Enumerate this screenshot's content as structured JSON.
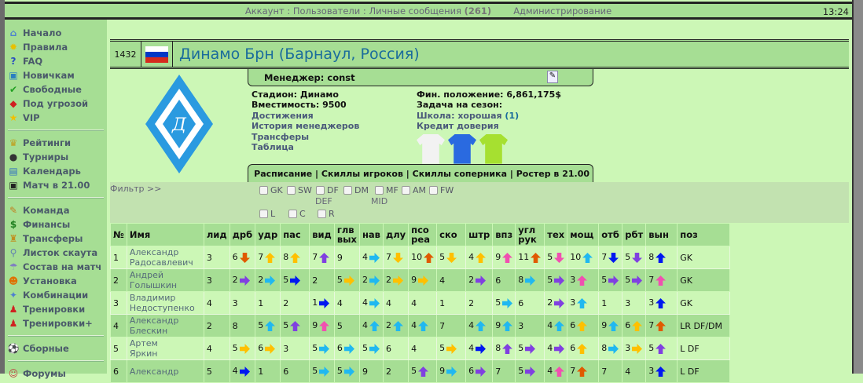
{
  "topbar": {
    "account": "Аккаунт",
    "users": "Пользователи",
    "messages": "Личные сообщения",
    "messages_count": "(261)",
    "sep": ":",
    "admin": "Администрирование",
    "clock": "13:24"
  },
  "sidebar": {
    "groups": [
      [
        {
          "label": "Начало",
          "icon": "home-icon",
          "g": "⌂",
          "c": "#4a7fd0"
        },
        {
          "label": "Правила",
          "icon": "lightbulb-icon",
          "g": "✹",
          "c": "#e8c000"
        },
        {
          "label": "FAQ",
          "icon": "help-icon",
          "g": "?",
          "c": "#2a4fc0"
        },
        {
          "label": "Новичкам",
          "icon": "newbie-icon",
          "g": "▣",
          "c": "#2a7fc0"
        },
        {
          "label": "Свободные",
          "icon": "checkmark-icon",
          "g": "✔",
          "c": "#20a020"
        },
        {
          "label": "Под угрозой",
          "icon": "warning-icon",
          "g": "◆",
          "c": "#d02020"
        },
        {
          "label": "VIP",
          "icon": "star-icon",
          "g": "★",
          "c": "#f0c000"
        }
      ],
      [
        {
          "label": "Рейтинги",
          "icon": "trophy-icon",
          "g": "♛",
          "c": "#c0a020"
        },
        {
          "label": "Турниры",
          "icon": "ball-icon",
          "g": "●",
          "c": "#333"
        },
        {
          "label": "Календарь",
          "icon": "calendar-icon",
          "g": "▤",
          "c": "#3070c0"
        },
        {
          "label": "Матч в 21.00",
          "icon": "tv-icon",
          "g": "▣",
          "c": "#222"
        }
      ],
      [
        {
          "label": "Команда",
          "icon": "team-icon",
          "g": "✎",
          "c": "#c08020"
        },
        {
          "label": "Финансы",
          "icon": "money-icon",
          "g": "$",
          "c": "#208020"
        },
        {
          "label": "Трансферы",
          "icon": "transfer-icon",
          "g": "♜",
          "c": "#c09020"
        },
        {
          "label": "Листок скаута",
          "icon": "scout-icon",
          "g": "⚲",
          "c": "#6080b0"
        },
        {
          "label": "Состав на матч",
          "icon": "lineup-icon",
          "g": "☂",
          "c": "#8080c0"
        },
        {
          "label": "Установка",
          "icon": "tactics-icon",
          "g": "☻",
          "c": "#e07000"
        },
        {
          "label": "Комбинации",
          "icon": "combinations-icon",
          "g": "✦",
          "c": "#5080d0"
        },
        {
          "label": "Тренировки",
          "icon": "training-icon",
          "g": "♟",
          "c": "#d02020"
        },
        {
          "label": "Тренировки+",
          "icon": "training-plus-icon",
          "g": "♟",
          "c": "#d02020"
        }
      ],
      [
        {
          "label": "Сборные",
          "icon": "fifa-icon",
          "g": "⚽",
          "c": "#2050c0"
        }
      ],
      [
        {
          "label": "Форумы",
          "icon": "forum-icon",
          "g": "☺",
          "c": "#c04040"
        }
      ]
    ]
  },
  "team": {
    "id": "1432",
    "name": "Динамо Брн (Барнаул, Россия)",
    "manager_label": "Менеджер:",
    "manager": "const",
    "stadium": "Стадион: Динамо",
    "capacity": "Вместимость: 9500",
    "achievements": "Достижения",
    "mgr_history": "История менеджеров",
    "transfers": "Трансферы",
    "table": "Таблица",
    "finance": "Фин. положение: 6,861,175$",
    "task": "Задача на сезон:",
    "school": "Школа: хорошая",
    "school_count": "(1)",
    "credit": "Кредит доверия",
    "shirt_colors": [
      "#f2f2f2",
      "#2a6ae0",
      "#a6e030"
    ]
  },
  "tabs": {
    "schedule": "Расписание",
    "skills": "Скиллы игроков",
    "opp_skills": "Скиллы соперника",
    "roster": "Ростер в 21.00",
    "sep": "|"
  },
  "filter": {
    "label": "Фильтр >>",
    "positions": [
      "GK",
      "SW",
      "DF",
      "DM",
      "MF",
      "AM",
      "FW"
    ],
    "def": "DEF",
    "mid": "MID",
    "sides": [
      "L",
      "C",
      "R"
    ]
  },
  "table": {
    "headers": [
      "№",
      "Имя",
      "лид",
      "дрб",
      "удр",
      "пас",
      "вид",
      "глв вых",
      "нав",
      "длу",
      "псо реа",
      "ско",
      "штр",
      "впз",
      "угл рук",
      "тех",
      "мощ",
      "отб",
      "рбт",
      "вын",
      "поз"
    ],
    "arrow_colors": {
      "r": "#e05a00",
      "o": "#f07a10",
      "y": "#ffc000",
      "p": "#8040e0",
      "c": "#20b8f0",
      "b": "#0018f0",
      "k": "#f050b0"
    },
    "rows": [
      {
        "n": "1",
        "first": "Александр",
        "last": "Радосавлевич",
        "pos": "GK",
        "s": [
          "3",
          "6:d:r",
          "7:u:y",
          "8:u:y",
          "7:u:p",
          "9",
          "4:r:c",
          "7:d:y",
          "10:u:r",
          "5:d:y",
          "4:u:y",
          "9:u:k",
          "11:u:r",
          "5:d:k",
          "10:u:c",
          "7:d:b",
          "5:d:p",
          "8:u:b"
        ]
      },
      {
        "n": "2",
        "first": "Андрей",
        "last": "Голышкин",
        "pos": "GK",
        "s": [
          "3",
          "2:r:p",
          "2:r:c",
          "5:r:b",
          "2",
          "5:r:y",
          "2:r:c",
          "2:r:y",
          "9:r:y",
          "4",
          "2:r:p",
          "6",
          "8:r:c",
          "5:r:p",
          "3:u:k",
          "5:r:p",
          "5:r:p",
          "7:u:k"
        ]
      },
      {
        "n": "3",
        "first": "Владимир",
        "last": "Недоступенко",
        "pos": "GK",
        "s": [
          "4",
          "3",
          "1",
          "2",
          "1:r:b",
          "4",
          "4:r:c",
          "4",
          "4",
          "1",
          "2",
          "5:r:c",
          "6",
          "2:r:p",
          "3:u:c",
          "1",
          "3",
          "3:u:b"
        ]
      },
      {
        "n": "4",
        "first": "Александр",
        "last": "Блескин",
        "pos": "LR DF/DM",
        "s": [
          "2",
          "8",
          "5:u:c",
          "5:u:p",
          "9:u:k",
          "5",
          "4:u:c",
          "2:u:c",
          "4:u:c",
          "7",
          "4:u:c",
          "9:u:c",
          "3",
          "4:u:c",
          "6:u:y",
          "9:u:c",
          "6:u:y",
          "7:u:r"
        ]
      },
      {
        "n": "5",
        "first": "Артем",
        "last": "Яркин",
        "pos": "L DF",
        "s": [
          "4",
          "5:r:y",
          "6:r:y",
          "3",
          "5:r:c",
          "6:r:c",
          "5:r:c",
          "6",
          "4",
          "5:r:y",
          "4:r:b",
          "8:u:p",
          "5:r:p",
          "4:r:p",
          "6:u:y",
          "8:r:c",
          "3:r:y",
          "5:u:p"
        ]
      },
      {
        "n": "6",
        "first": "Александр",
        "last": "",
        "pos": "L DF",
        "s": [
          "5",
          "4:r:b",
          "1",
          "6",
          "5:r:c",
          "5:r:c",
          "9",
          "2",
          "5:u:p",
          "9:r:c",
          "6:r:p",
          "7",
          "5:r:p",
          "4:u:k",
          "7:u:r",
          "7",
          "4",
          "3:u:b"
        ]
      }
    ]
  }
}
